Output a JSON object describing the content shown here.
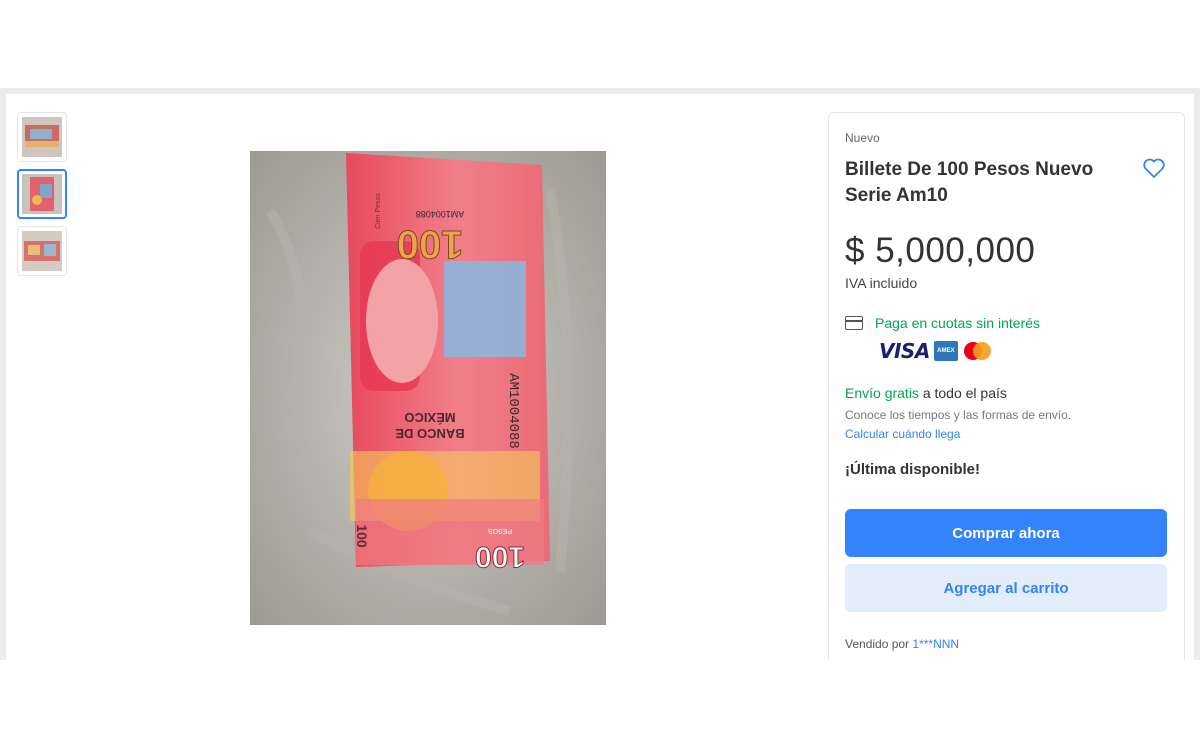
{
  "gallery": {
    "thumbnails": [
      {
        "name": "thumbnail-1",
        "active": false
      },
      {
        "name": "thumbnail-2",
        "active": true
      },
      {
        "name": "thumbnail-3",
        "active": false
      }
    ]
  },
  "banknote": {
    "serial_top": "AM1004088",
    "serial_side": "AM1004088",
    "denomination": "100",
    "bank_line1": "BANCO DE",
    "bank_line2": "MÉXICO",
    "pesos": "PESOS",
    "cien": "Cien Pesos"
  },
  "product": {
    "condition": "Nuevo",
    "title": "Billete De 100 Pesos Nuevo Serie Am10",
    "price": "$ 5,000,000",
    "tax_note": "IVA incluido"
  },
  "payment": {
    "installments_text": "Paga en cuotas sin interés",
    "brands": [
      "visa-logo",
      "amex-logo",
      "mastercard-logo"
    ],
    "visa_label": "VISA",
    "amex_label": "AMEX"
  },
  "shipping": {
    "free_label": "Envío gratis",
    "rest": " a todo el país",
    "note": "Conoce los tiempos y las formas de envío.",
    "calc_link": "Calcular cuándo llega"
  },
  "stock": {
    "label": "¡Última disponible!"
  },
  "actions": {
    "buy_now": "Comprar ahora",
    "add_to_cart": "Agregar al carrito"
  },
  "seller": {
    "prefix": "Vendido por ",
    "name": "1***NNN"
  },
  "colors": {
    "accent": "#3483fa",
    "success": "#00a650",
    "cart_bg": "#e3edfb"
  }
}
